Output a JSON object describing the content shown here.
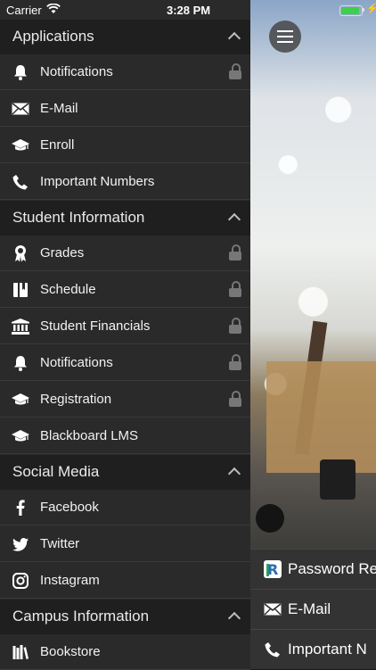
{
  "status_bar": {
    "carrier": "Carrier",
    "time": "3:28 PM",
    "battery_level": 0.9
  },
  "drawer": {
    "sections": [
      {
        "title": "Applications",
        "items": [
          {
            "label": "Notifications",
            "icon": "bell-icon",
            "locked": true
          },
          {
            "label": "E-Mail",
            "icon": "mail-icon",
            "locked": false
          },
          {
            "label": "Enroll",
            "icon": "graduation-cap-icon",
            "locked": false
          },
          {
            "label": "Important Numbers",
            "icon": "phone-icon",
            "locked": false
          }
        ]
      },
      {
        "title": "Student Information",
        "items": [
          {
            "label": "Grades",
            "icon": "award-icon",
            "locked": true
          },
          {
            "label": "Schedule",
            "icon": "book-icon",
            "locked": true
          },
          {
            "label": "Student Financials",
            "icon": "bank-icon",
            "locked": true
          },
          {
            "label": "Notifications",
            "icon": "bell-icon",
            "locked": true
          },
          {
            "label": "Registration",
            "icon": "graduation-cap-icon",
            "locked": true
          },
          {
            "label": "Blackboard LMS",
            "icon": "graduation-cap-icon",
            "locked": false
          }
        ]
      },
      {
        "title": "Social Media",
        "items": [
          {
            "label": "Facebook",
            "icon": "facebook-icon",
            "locked": false
          },
          {
            "label": "Twitter",
            "icon": "twitter-icon",
            "locked": false
          },
          {
            "label": "Instagram",
            "icon": "instagram-icon",
            "locked": false
          }
        ]
      },
      {
        "title": "Campus Information",
        "items": [
          {
            "label": "Bookstore",
            "icon": "books-icon",
            "locked": false
          }
        ]
      }
    ]
  },
  "quick_links": [
    {
      "label": "Password Re",
      "icon": "r-logo-icon"
    },
    {
      "label": "E-Mail",
      "icon": "mail-icon"
    },
    {
      "label": "Important N",
      "icon": "phone-icon"
    }
  ],
  "colors": {
    "drawer_bg": "#2a2a2a",
    "header_bg": "#1f1f1f",
    "battery": "#3ecf4b",
    "brand_blue": "#2a6bb6"
  }
}
